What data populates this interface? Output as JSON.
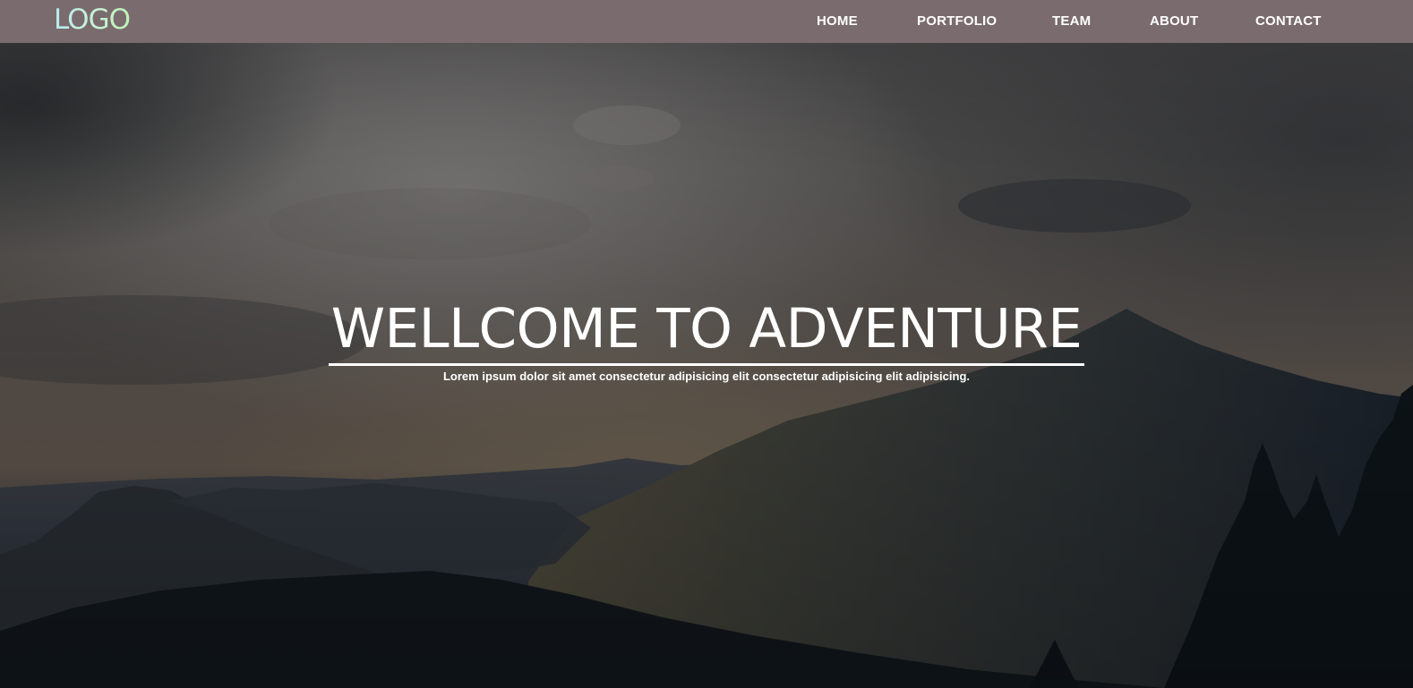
{
  "header": {
    "logo_text": "LOGO",
    "nav": {
      "home": "HOME",
      "portfolio": "PORTFOLIO",
      "team": "TEAM",
      "about": "ABOUT",
      "contact": "CONTACT"
    }
  },
  "hero": {
    "title": "WELLCOME TO ADVENTURE",
    "subtitle": "Lorem ipsum dolor sit amet consectetur adipisicing elit consectetur adipisicing elit adipisicing."
  },
  "colors": {
    "navbar_bg": "#7a6b6e",
    "logo_gradient": [
      "#b6ecef",
      "#bdf2b4"
    ],
    "text": "#ffffff"
  }
}
